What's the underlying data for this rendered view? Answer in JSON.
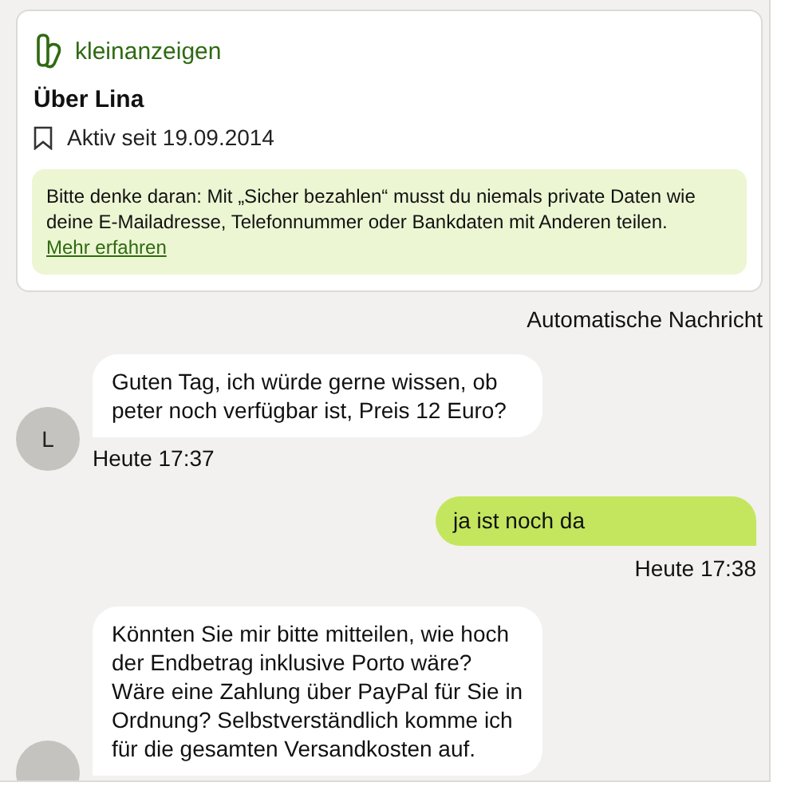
{
  "profile_card": {
    "brand": "kleinanzeigen",
    "heading": "Über Lina",
    "active_since": "Aktiv seit 19.09.2014",
    "notice": "Bitte denke daran: Mit „Sicher bezahlen“ musst du niemals private Daten wie deine E-Mailadresse, Telefonnummer oder Bankdaten mit Anderen teilen.",
    "notice_link": "Mehr erfahren"
  },
  "system_label": "Automatische Nachricht",
  "messages": [
    {
      "kind": "incoming",
      "avatar": "L",
      "text": "Guten Tag, ich würde gerne wissen, ob peter noch verfügbar ist, Preis 12 Euro?",
      "time": "Heute 17:37"
    },
    {
      "kind": "outgoing",
      "text": "ja ist noch da",
      "time": "Heute 17:38"
    },
    {
      "kind": "incoming",
      "text": "Könnten Sie mir bitte mitteilen, wie hoch der Endbetrag inklusive Porto wäre? Wäre eine Zahlung über PayPal für Sie in Ordnung? Selbstverständlich komme ich für die gesamten Versandkosten auf."
    }
  ]
}
